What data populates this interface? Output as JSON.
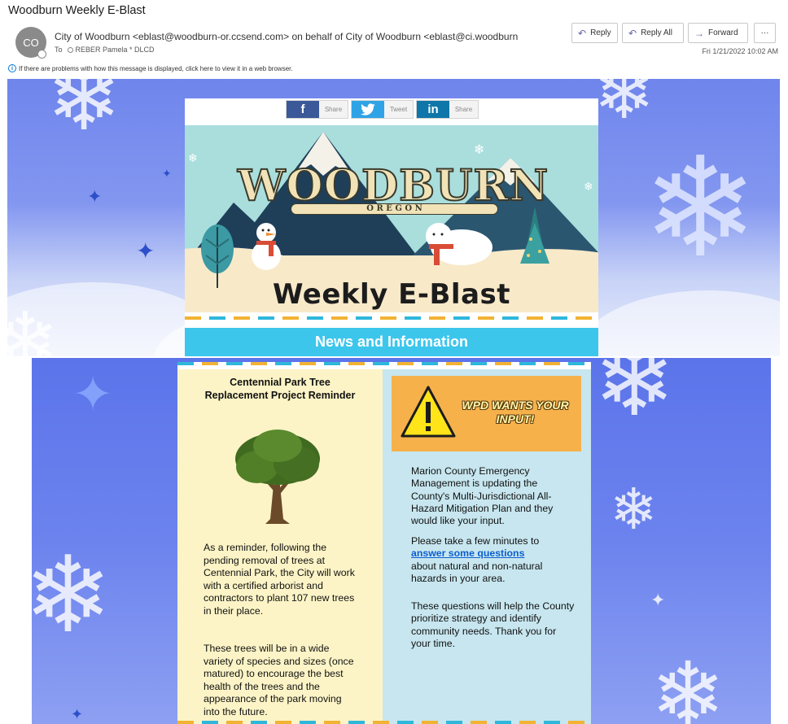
{
  "email": {
    "subject": "Woodburn Weekly E-Blast",
    "avatar_initials": "CO",
    "from_line": "City of Woodburn <eblast@woodburn-or.ccsend.com> on behalf of City of Woodburn <eblast@ci.woodburn",
    "to_label": "To",
    "to_recipient": "REBER Pamela * DLCD",
    "date": "Fri 1/21/2022 10:02 AM",
    "info_bar": "If there are problems with how this message is displayed, click here to view it in a web browser.",
    "actions": {
      "reply": "Reply",
      "reply_all": "Reply All",
      "forward": "Forward",
      "more": "···"
    }
  },
  "newsletter": {
    "share": [
      {
        "icon": "f",
        "label": "Share",
        "color": "#3b5998"
      },
      {
        "icon": "t",
        "label": "Tweet",
        "color": "#2fa3e6"
      },
      {
        "icon": "in",
        "label": "Share",
        "color": "#0e76a8"
      }
    ],
    "banner": {
      "logo": "WOODBURN",
      "state": "O  R  E  G  O  N",
      "title": "Weekly E-Blast"
    },
    "section_header": "News and Information",
    "left": {
      "title": "Centennial Park Tree Replacement Project Reminder",
      "para1": "As a reminder, following the pending removal of trees at Centennial Park, the City will work with a certified arborist and contractors to plant 107 new trees in their place.",
      "para2": "These trees will be in a wide variety of species and sizes (once matured) to encourage the best health of the trees and the appearance of the park moving into the future."
    },
    "right": {
      "image_text": "WPD WANTS YOUR INPUT!",
      "para1": "Marion County Emergency Management is updating the County's Multi-Jurisdictional All-Hazard Mitigation Plan and they would like your input.",
      "para2_before": "Please take a few minutes to",
      "para2_link": "answer some questions",
      "para2_after": "about natural and non-natural hazards in your area.",
      "para3": "These questions will help the County prioritize strategy and identify community needs. Thank you for your time."
    }
  }
}
